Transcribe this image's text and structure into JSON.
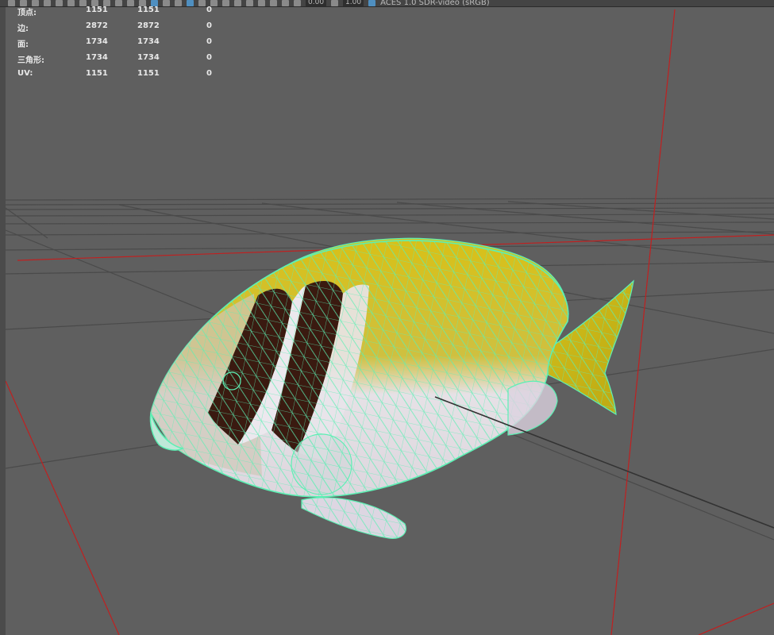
{
  "toolbar": {
    "field1": "0.00",
    "field2": "1.00",
    "color_management": "ACES 1.0 SDR-video (sRGB)"
  },
  "stats": {
    "rows": [
      {
        "label": "顶点:",
        "v1": "1151",
        "v2": "1151",
        "v3": "0"
      },
      {
        "label": "边:",
        "v1": "2872",
        "v2": "2872",
        "v3": "0"
      },
      {
        "label": "面:",
        "v1": "1734",
        "v2": "1734",
        "v3": "0"
      },
      {
        "label": "三角形:",
        "v1": "1734",
        "v2": "1734",
        "v3": "0"
      },
      {
        "label": "UV:",
        "v1": "1151",
        "v2": "1151",
        "v3": "0"
      }
    ]
  },
  "colors": {
    "viewport_bg": "#5f5f5f",
    "grid": "#4a4a4a",
    "axis_red": "#c02020",
    "wireframe": "#5cf0b4",
    "fish_yellow": "#d8c018",
    "fish_white": "#e6e1e6",
    "stripe_dark": "#3a1a10"
  }
}
